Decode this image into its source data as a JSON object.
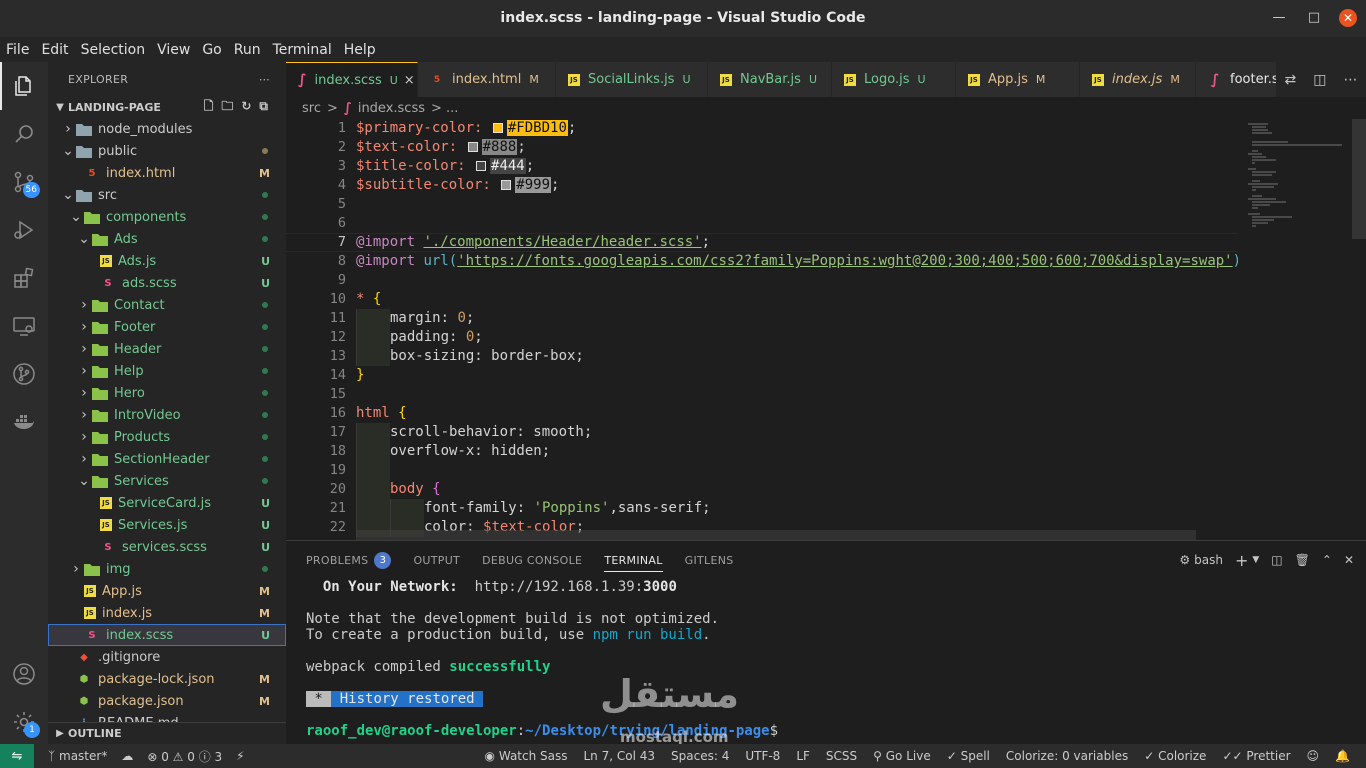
{
  "window": {
    "title": "index.scss - landing-page - Visual Studio Code"
  },
  "menu": [
    "File",
    "Edit",
    "Selection",
    "View",
    "Go",
    "Run",
    "Terminal",
    "Help"
  ],
  "activity": {
    "scm_badge": "56",
    "accounts_badge": "1"
  },
  "explorer": {
    "header": "EXPLORER",
    "project": "LANDING-PAGE",
    "outline": "OUTLINE",
    "items": [
      {
        "label": "node_modules",
        "kind": "folder",
        "depth": 1,
        "open": false,
        "color": "def",
        "status": ""
      },
      {
        "label": "public",
        "kind": "folder",
        "depth": 1,
        "open": true,
        "color": "def",
        "status": "dot-mod"
      },
      {
        "label": "index.html",
        "kind": "html",
        "depth": 2,
        "open": false,
        "color": "mod",
        "status": "M"
      },
      {
        "label": "src",
        "kind": "folder",
        "depth": 1,
        "open": true,
        "color": "def",
        "status": "dot-green"
      },
      {
        "label": "components",
        "kind": "folder",
        "depth": 2,
        "open": true,
        "color": "green",
        "status": "dot-green"
      },
      {
        "label": "Ads",
        "kind": "folder",
        "depth": 3,
        "open": true,
        "color": "green",
        "status": "dot-green"
      },
      {
        "label": "Ads.js",
        "kind": "js",
        "depth": 4,
        "open": false,
        "color": "green",
        "status": "U"
      },
      {
        "label": "ads.scss",
        "kind": "scss",
        "depth": 4,
        "open": false,
        "color": "green",
        "status": "U"
      },
      {
        "label": "Contact",
        "kind": "folder",
        "depth": 3,
        "open": false,
        "color": "green",
        "status": "dot-green"
      },
      {
        "label": "Footer",
        "kind": "folder",
        "depth": 3,
        "open": false,
        "color": "green",
        "status": "dot-green"
      },
      {
        "label": "Header",
        "kind": "folder",
        "depth": 3,
        "open": false,
        "color": "green",
        "status": "dot-green"
      },
      {
        "label": "Help",
        "kind": "folder",
        "depth": 3,
        "open": false,
        "color": "green",
        "status": "dot-green"
      },
      {
        "label": "Hero",
        "kind": "folder",
        "depth": 3,
        "open": false,
        "color": "green",
        "status": "dot-green"
      },
      {
        "label": "IntroVideo",
        "kind": "folder",
        "depth": 3,
        "open": false,
        "color": "green",
        "status": "dot-green"
      },
      {
        "label": "Products",
        "kind": "folder",
        "depth": 3,
        "open": false,
        "color": "green",
        "status": "dot-green"
      },
      {
        "label": "SectionHeader",
        "kind": "folder",
        "depth": 3,
        "open": false,
        "color": "green",
        "status": "dot-green"
      },
      {
        "label": "Services",
        "kind": "folder",
        "depth": 3,
        "open": true,
        "color": "green",
        "status": "dot-green"
      },
      {
        "label": "ServiceCard.js",
        "kind": "js",
        "depth": 4,
        "open": false,
        "color": "green",
        "status": "U"
      },
      {
        "label": "Services.js",
        "kind": "js",
        "depth": 4,
        "open": false,
        "color": "green",
        "status": "U"
      },
      {
        "label": "services.scss",
        "kind": "scss",
        "depth": 4,
        "open": false,
        "color": "green",
        "status": "U"
      },
      {
        "label": "img",
        "kind": "folder",
        "depth": 2,
        "open": false,
        "color": "green",
        "status": "dot-green"
      },
      {
        "label": "App.js",
        "kind": "js",
        "depth": 2,
        "open": false,
        "color": "mod",
        "status": "M"
      },
      {
        "label": "index.js",
        "kind": "js",
        "depth": 2,
        "open": false,
        "color": "mod",
        "status": "M"
      },
      {
        "label": "index.scss",
        "kind": "scss",
        "depth": 2,
        "open": false,
        "color": "green",
        "status": "U",
        "selected": true
      },
      {
        "label": ".gitignore",
        "kind": "git",
        "depth": 1,
        "open": false,
        "color": "def",
        "status": ""
      },
      {
        "label": "package-lock.json",
        "kind": "node",
        "depth": 1,
        "open": false,
        "color": "mod",
        "status": "M"
      },
      {
        "label": "package.json",
        "kind": "node",
        "depth": 1,
        "open": false,
        "color": "mod",
        "status": "M"
      },
      {
        "label": "README.md",
        "kind": "info",
        "depth": 1,
        "open": false,
        "color": "def",
        "status": ""
      }
    ]
  },
  "tabs": [
    {
      "label": "index.scss",
      "kind": "scss",
      "status": "U",
      "active": true,
      "close": "×"
    },
    {
      "label": "index.html",
      "kind": "html",
      "status": "M",
      "active": false,
      "close": ""
    },
    {
      "label": "SocialLinks.js",
      "kind": "js",
      "status": "U",
      "active": false,
      "close": ""
    },
    {
      "label": "NavBar.js",
      "kind": "js",
      "status": "U",
      "active": false,
      "close": ""
    },
    {
      "label": "Logo.js",
      "kind": "js",
      "status": "U",
      "active": false,
      "close": ""
    },
    {
      "label": "App.js",
      "kind": "js",
      "status": "M",
      "active": false,
      "close": ""
    },
    {
      "label": "index.js",
      "kind": "js",
      "status": "M",
      "active": false,
      "close": ""
    },
    {
      "label": "footer.s",
      "kind": "scss",
      "status": "",
      "active": false,
      "close": ""
    }
  ],
  "breadcrumb": {
    "part1": "src",
    "sep": ">",
    "part2": "index.scss",
    "sep2": "> ..."
  },
  "editor": {
    "line_numbers": [
      "1",
      "2",
      "3",
      "4",
      "5",
      "6",
      "7",
      "8",
      "9",
      "10",
      "11",
      "12",
      "13",
      "14",
      "15",
      "16",
      "17",
      "18",
      "19",
      "20",
      "21",
      "22"
    ],
    "current_line": "7",
    "colors": {
      "primary": "#FDBD10",
      "text": "#888",
      "title": "#444",
      "subtitle": "#999"
    },
    "code": {
      "l1_var": "$primary-color:",
      "l1_val": "#FDBD10",
      "l1_end": ";",
      "l2_var": "$text-color:",
      "l2_val": "#888",
      "l2_end": ";",
      "l3_var": "$title-color:",
      "l3_val": "#444",
      "l3_end": ";",
      "l4_var": "$subtitle-color:",
      "l4_val": "#999",
      "l4_end": ";",
      "l7_kw": "@import",
      "l7_str": "'./components/Header/header.scss'",
      "l7_end": ";",
      "l8_kw": "@import",
      "l8_fn": "url(",
      "l8_str": "'https://fonts.googleapis.com/css2?family=Poppins:wght@200;300;400;500;600;700&display=swap'",
      "l8_end": ")",
      "l10_sel": "*",
      "l10_brace": "{",
      "l11": "margin: ",
      "l11_num": "0",
      "l11_end": ";",
      "l12": "padding: ",
      "l12_num": "0",
      "l12_end": ";",
      "l13": "box-sizing: border-box;",
      "l14": "}",
      "l16_sel": "html",
      "l16_brace": "{",
      "l17": "scroll-behavior: smooth;",
      "l18": "overflow-x: hidden;",
      "l20_sel": "body",
      "l20_brace": "{",
      "l21_a": "font-family: ",
      "l21_str": "'Poppins'",
      "l21_b": ",sans-serif;",
      "l22_a": "color: ",
      "l22_var": "$text-color",
      "l22_end": ";"
    }
  },
  "panel": {
    "tabs": [
      "PROBLEMS",
      "OUTPUT",
      "DEBUG CONSOLE",
      "TERMINAL",
      "GITLENS"
    ],
    "problems_count": "3",
    "shell": "bash",
    "terminal": {
      "l1_label": "On Your Network:",
      "l1_url": "http://192.168.1.39:",
      "l1_port": "3000",
      "l2": "Note that the development build is not optimized.",
      "l3_a": "To create a production build, use ",
      "l3_cmd": "npm run build",
      "l3_b": ".",
      "l4_a": "webpack compiled ",
      "l4_b": "successfully",
      "l5_star": " * ",
      "l5_msg": " History restored ",
      "prompt_user": "raoof_dev@raoof-developer",
      "prompt_sep": ":",
      "prompt_path": "~/Desktop/trying/landing-page",
      "prompt_end": "$"
    }
  },
  "watermark": {
    "ar": "مستقل",
    "en": "mostaql.com"
  },
  "statusbar": {
    "branch": "master*",
    "errors": "0",
    "warnings": "0",
    "info": "3",
    "watch": "Watch Sass",
    "position": "Ln 7, Col 43",
    "spaces": "Spaces: 4",
    "encoding": "UTF-8",
    "eol": "LF",
    "language": "SCSS",
    "golive": "Go Live",
    "spell": "Spell",
    "colorize_vars": "Colorize: 0 variables",
    "colorize": "Colorize",
    "prettier": "Prettier"
  }
}
